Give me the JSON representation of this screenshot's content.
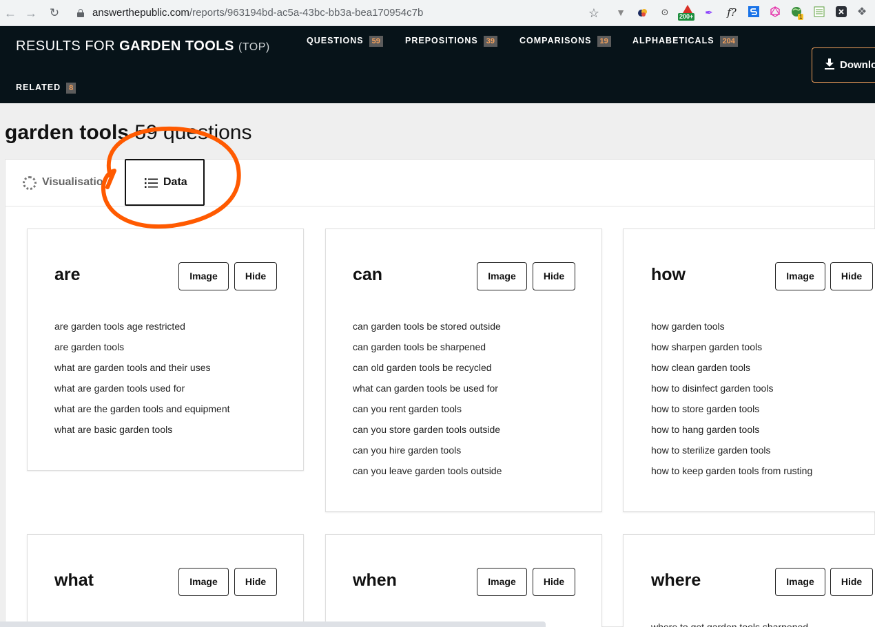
{
  "browser": {
    "url_host": "answerthepublic.com",
    "url_path": "/reports/963194bd-ac5a-43bc-bb3a-bea170954c7b",
    "extension_badge": "200+",
    "extension_badge2": "1"
  },
  "header": {
    "results_prefix": "RESULTS FOR",
    "keyword": "GARDEN TOOLS",
    "scope": "(TOP)",
    "tabs": [
      {
        "label": "QUESTIONS",
        "count": "59"
      },
      {
        "label": "PREPOSITIONS",
        "count": "39"
      },
      {
        "label": "COMPARISONS",
        "count": "19"
      },
      {
        "label": "ALPHABETICALS",
        "count": "204"
      },
      {
        "label": "RELATED",
        "count": "8"
      }
    ],
    "download_label": "Downlo"
  },
  "heading": {
    "keyword": "garden tools",
    "count_text": " 59 questions"
  },
  "view_tabs": {
    "visualisation": "Visualisatio",
    "data": "Data"
  },
  "cards": [
    {
      "title": "are",
      "image_label": "Image",
      "hide_label": "Hide",
      "items": [
        "are garden tools age restricted",
        "are garden tools",
        "what are garden tools and their uses",
        "what are garden tools used for",
        "what are the garden tools and equipment",
        "what are basic garden tools"
      ]
    },
    {
      "title": "can",
      "image_label": "Image",
      "hide_label": "Hide",
      "items": [
        "can garden tools be stored outside",
        "can garden tools be sharpened",
        "can old garden tools be recycled",
        "what can garden tools be used for",
        "can you rent garden tools",
        "can you store garden tools outside",
        "can you hire garden tools",
        "can you leave garden tools outside"
      ]
    },
    {
      "title": "how",
      "image_label": "Image",
      "hide_label": "Hide",
      "items": [
        "how garden tools",
        "how sharpen garden tools",
        "how clean garden tools",
        "how to disinfect garden tools",
        "how to store garden tools",
        "how to hang garden tools",
        "how to sterilize garden tools",
        "how to keep garden tools from rusting"
      ]
    },
    {
      "title": "what",
      "image_label": "Image",
      "hide_label": "Hide",
      "items": []
    },
    {
      "title": "when",
      "image_label": "Image",
      "hide_label": "Hide",
      "items": []
    },
    {
      "title": "where",
      "image_label": "Image",
      "hide_label": "Hide",
      "items": [
        "where to get garden tools sharpened"
      ]
    }
  ],
  "colors": {
    "header_bg": "#071319",
    "badge_text": "#f6a25c",
    "annotation": "#ff5a00"
  }
}
